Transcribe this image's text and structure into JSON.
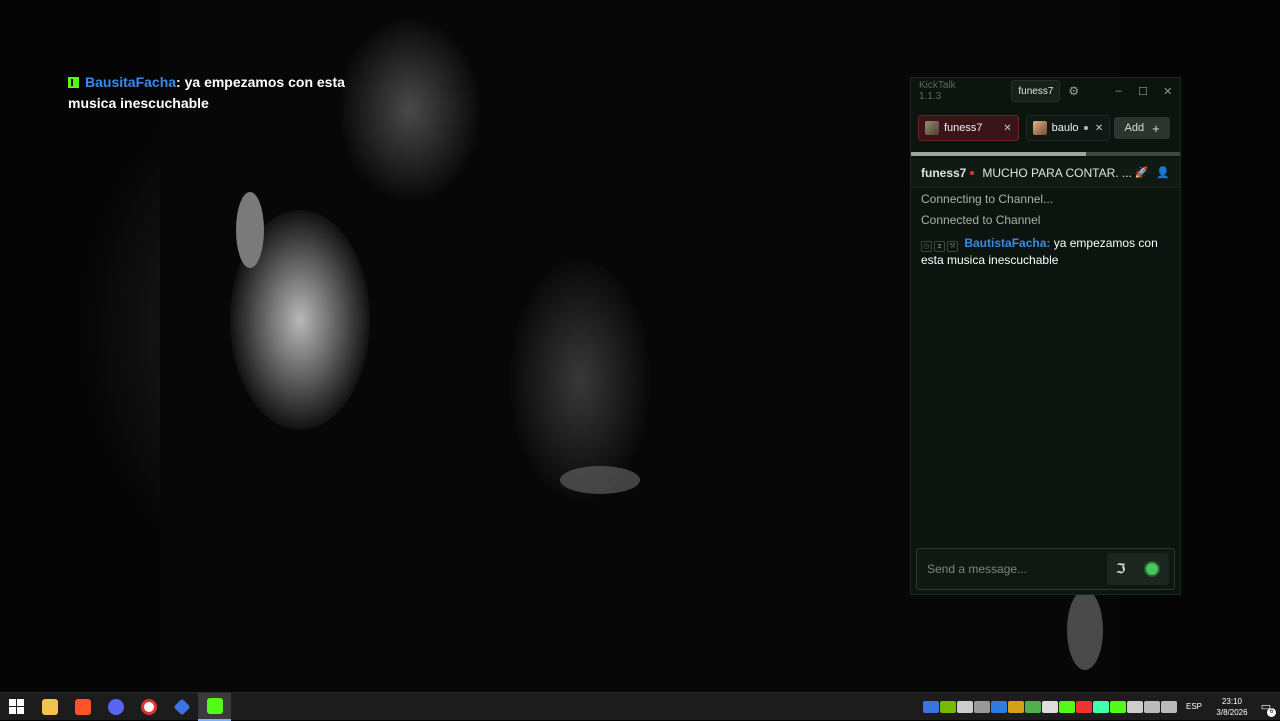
{
  "overlay": {
    "username": "BausitaFacha",
    "separator": ":",
    "message": "ya empezamos con esta musica inescuchable"
  },
  "kicktalk": {
    "title": "KickTalk 1.1.3",
    "current_user": "funess7",
    "settings_icon": "gear-icon",
    "window_controls": {
      "minimize": "–",
      "maximize": "☐",
      "close": "✕"
    },
    "tabs": [
      {
        "label": "funess7",
        "close": "✕",
        "active": true
      },
      {
        "label": "baulo",
        "close": "✕",
        "active": false
      }
    ],
    "add_label": "Add",
    "add_icon": "+",
    "progress": 0.65,
    "channel": {
      "name": "funess7",
      "title": "MUCHO PARA CONTAR. ...",
      "icons": [
        "rocket-icon",
        "user-icon"
      ]
    },
    "messages": {
      "system": [
        "Connecting to Channel...",
        "Connected to Channel"
      ],
      "chat": [
        {
          "username": "BautistaFacha",
          "text": "ya empezamos con esta musica inescuchable"
        }
      ]
    },
    "input_placeholder": "Send a message...",
    "input_icons": [
      "translate-icon",
      "emote-icon"
    ]
  },
  "taskbar": {
    "apps": [
      "start-icon",
      "file-explorer-icon",
      "brave-icon",
      "discord-icon",
      "app-icon",
      "app-icon",
      "kick-icon"
    ],
    "language": "ESP",
    "time": "23:10",
    "date": "3/8/2026",
    "notifications_count": "6"
  },
  "colors": {
    "kick_green": "#53fc18",
    "username_blue": "#3a8ae8",
    "live_red": "#d8383a"
  }
}
